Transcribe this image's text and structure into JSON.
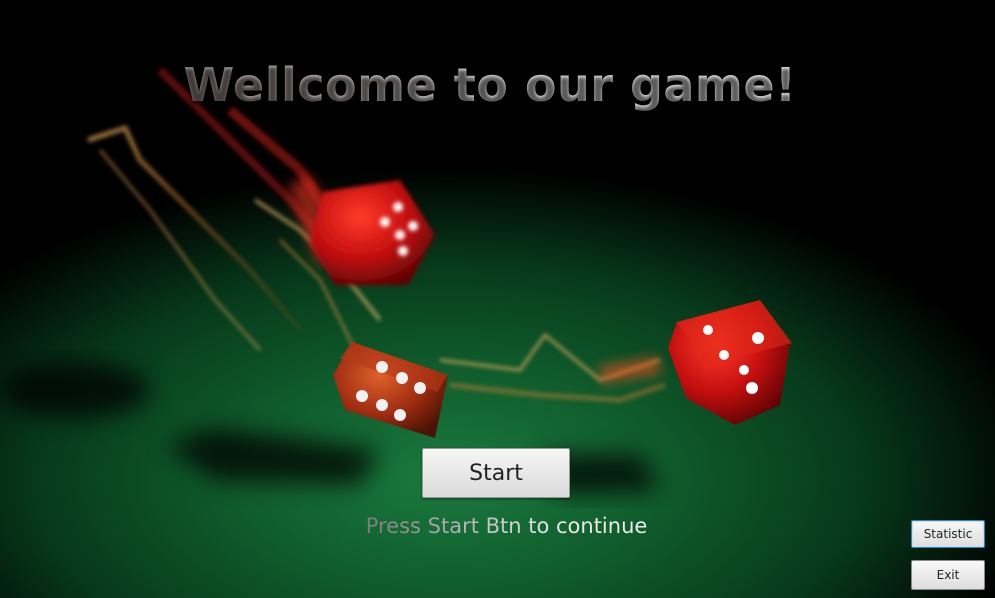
{
  "title": "Wellcome to our game!",
  "buttons": {
    "start": "Start",
    "statistic": "Statistic",
    "exit": "Exit"
  },
  "hint": "Press Start Btn to continue",
  "colors": {
    "table_felt": "#0f5a2b",
    "dice": "#d01010",
    "pips": "#ffffff"
  }
}
